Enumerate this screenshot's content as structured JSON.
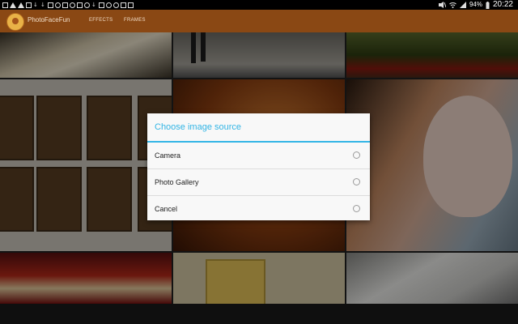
{
  "status_bar": {
    "battery_percent": "94%",
    "time": "20:22"
  },
  "app_bar": {
    "title": "PhotoFaceFun",
    "tabs": [
      {
        "label": "EFFECTS"
      },
      {
        "label": "FRAMES"
      }
    ]
  },
  "dialog": {
    "title": "Choose image source",
    "options": [
      {
        "label": "Camera",
        "selected": false
      },
      {
        "label": "Photo Gallery",
        "selected": false
      },
      {
        "label": "Cancel",
        "selected": false
      }
    ]
  },
  "colors": {
    "app_bar": "#8a4814",
    "dialog_accent": "#33b5e5",
    "overlay": "rgba(0,0,0,0.42)"
  },
  "gallery": {
    "tiles": [
      {
        "subject": "framed photo on table"
      },
      {
        "subject": "feet on stage"
      },
      {
        "subject": "flowers and greenery"
      },
      {
        "subject": "wall of framed cartoon pictures"
      },
      {
        "subject": "orange-toned photo"
      },
      {
        "subject": "woman kissing doll"
      },
      {
        "subject": "festive decorations"
      },
      {
        "subject": "framed cartoon girl"
      },
      {
        "subject": "sketches on paper"
      }
    ]
  }
}
